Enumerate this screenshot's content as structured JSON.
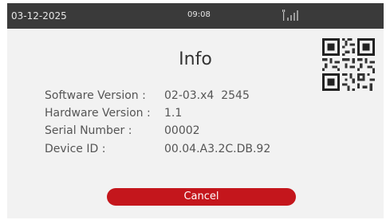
{
  "status_bar": {
    "date": "03-12-2025",
    "time": "09:08",
    "signal_icon": "signal-strength-icon",
    "bar_color": "#3a3a3a"
  },
  "info": {
    "title": "Info",
    "rows": [
      {
        "label": "Software Version :",
        "value": "02-03.x4  2545"
      },
      {
        "label": "Hardware Version :",
        "value": "1.1"
      },
      {
        "label": "Serial Number :",
        "value": "00002"
      },
      {
        "label": "Device ID :",
        "value": "00.04.A3.2C.DB.92"
      }
    ],
    "qr_icon": "qr-code-icon"
  },
  "actions": {
    "cancel_label": "Cancel",
    "cancel_color": "#c4161c"
  }
}
